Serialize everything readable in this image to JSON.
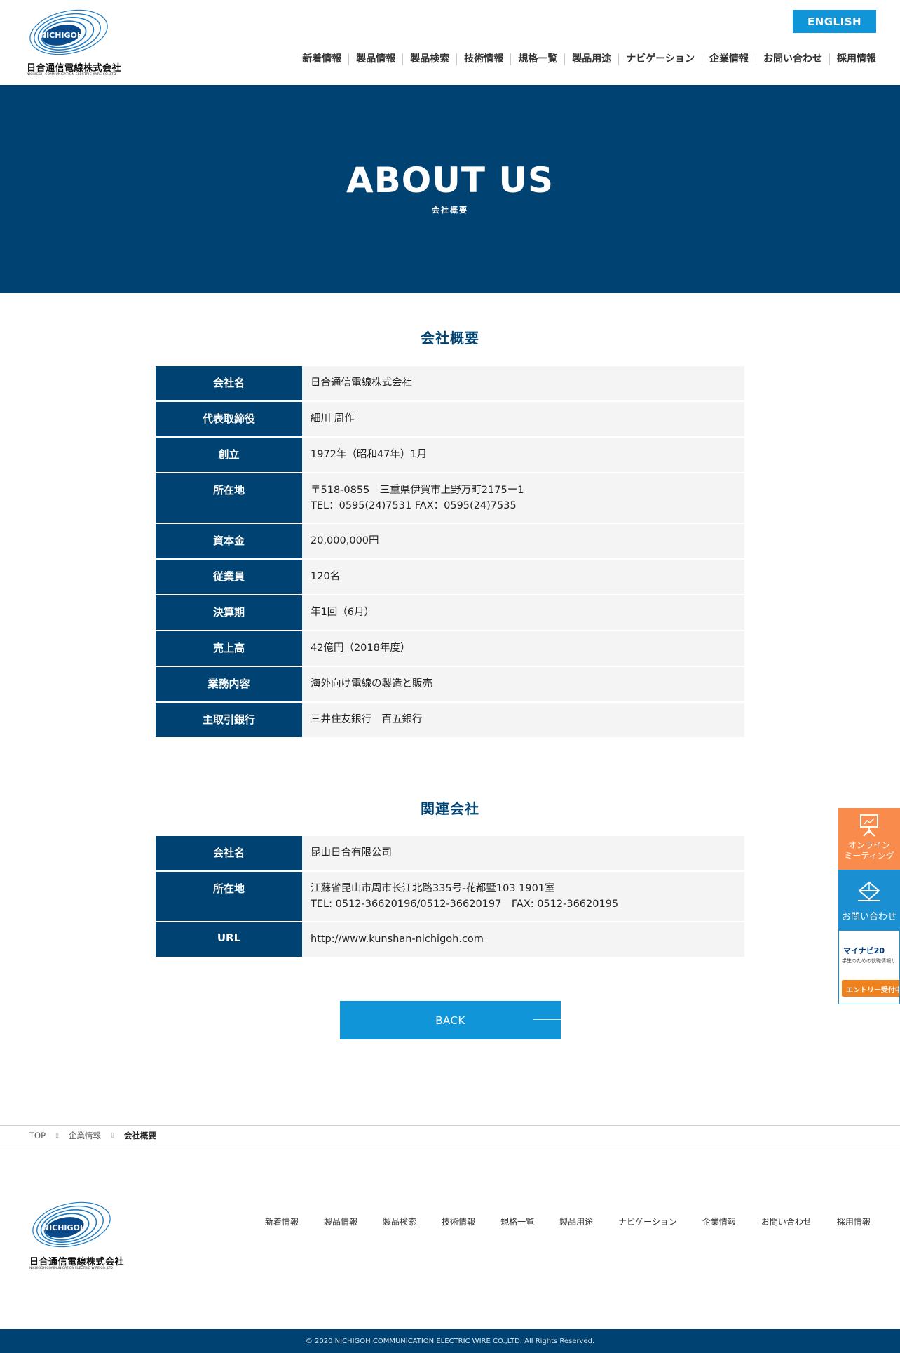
{
  "header": {
    "logo_brand": "NICHIGOH",
    "logo_jp": "日合通信電線株式会社",
    "logo_en": "NICHIGOH COMMUNICATION ELECTRIC WIRE CO.,LTD",
    "lang_button": "ENGLISH",
    "nav": [
      "新着情報",
      "製品情報",
      "製品検索",
      "技術情報",
      "規格一覧",
      "製品用途",
      "ナビゲーション",
      "企業情報",
      "お問い合わせ",
      "採用情報"
    ]
  },
  "hero": {
    "title": "ABOUT US",
    "subtitle": "会社概要"
  },
  "overview": {
    "title": "会社概要",
    "rows": [
      {
        "label": "会社名",
        "lines": [
          "日合通信電線株式会社"
        ]
      },
      {
        "label": "代表取締役",
        "lines": [
          "細川 周作"
        ]
      },
      {
        "label": "創立",
        "lines": [
          "1972年（昭和47年）1月"
        ]
      },
      {
        "label": "所在地",
        "lines": [
          "〒518-0855　三重県伊賀市上野万町2175ー1",
          "TEL：0595(24)7531 FAX：0595(24)7535"
        ]
      },
      {
        "label": "資本金",
        "lines": [
          "20,000,000円"
        ]
      },
      {
        "label": "従業員",
        "lines": [
          "120名"
        ]
      },
      {
        "label": "決算期",
        "lines": [
          "年1回（6月）"
        ]
      },
      {
        "label": "売上高",
        "lines": [
          "42億円（2018年度）"
        ]
      },
      {
        "label": "業務内容",
        "lines": [
          "海外向け電線の製造と販売"
        ]
      },
      {
        "label": "主取引銀行",
        "lines": [
          "三井住友銀行　百五銀行"
        ]
      }
    ]
  },
  "related": {
    "title": "関連会社",
    "rows": [
      {
        "label": "会社名",
        "lines": [
          "昆山日合有限公司"
        ]
      },
      {
        "label": "所在地",
        "lines": [
          "江蘇省昆山市周市长江北路335号-花都墅103 1901室",
          "TEL: 0512-36620196/0512-36620197　FAX: 0512-36620195"
        ]
      },
      {
        "label": "URL",
        "lines": [
          "http://www.kunshan-nichigoh.com"
        ]
      }
    ]
  },
  "back_button": "BACK",
  "side": {
    "online": [
      "オンライン",
      "ミーティング"
    ],
    "contact": "お問い合わせ",
    "mynavi_brand": "マイナビ20",
    "mynavi_tagline": "学生のための就職情報サ",
    "entry": "エントリー受付中"
  },
  "breadcrumb": {
    "items": [
      "TOP",
      "企業情報"
    ],
    "current": "会社概要"
  },
  "footer": {
    "logo_brand": "NICHIGOH",
    "logo_jp": "日合通信電線株式会社",
    "logo_en": "NICHIGOH COMMUNICATION ELECTRIC WIRE CO.,LTD",
    "nav": [
      "新着情報",
      "製品情報",
      "製品検索",
      "技術情報",
      "規格一覧",
      "製品用途",
      "ナビゲーション",
      "企業情報",
      "お問い合わせ",
      "採用情報"
    ],
    "copyright": "© 2020 NICHIGOH COMMUNICATION ELECTRIC WIRE CO.,LTD. All Rights Reserved."
  },
  "colors": {
    "navy": "#004372",
    "accent": "#0f95d8",
    "orange": "#f98c4c"
  }
}
